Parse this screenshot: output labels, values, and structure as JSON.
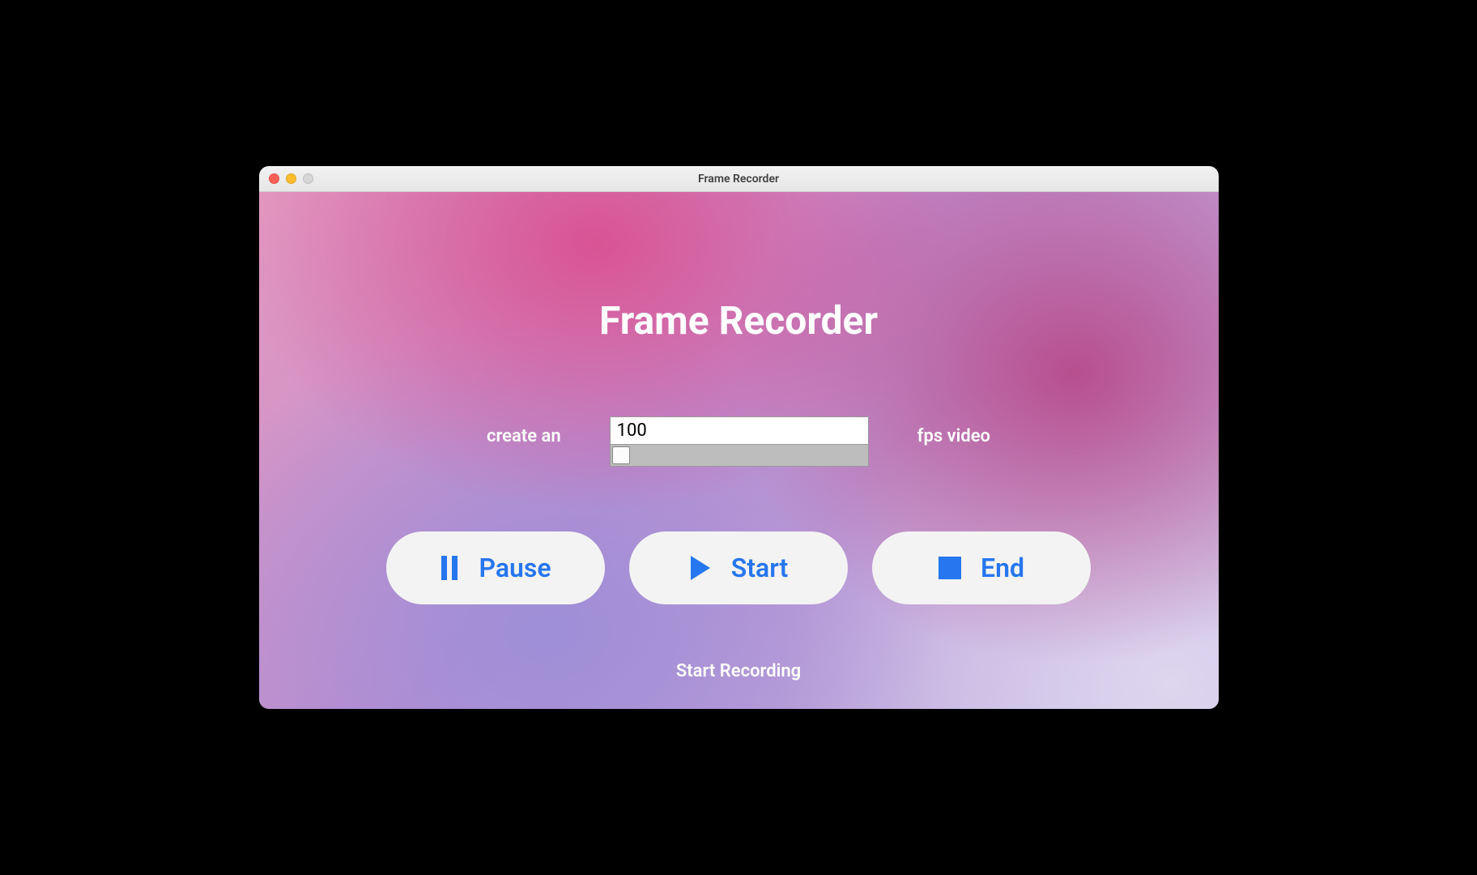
{
  "window": {
    "title": "Frame Recorder"
  },
  "main": {
    "app_title": "Frame Recorder",
    "fps": {
      "label_before": "create an",
      "label_after": "fps video",
      "value": "100"
    },
    "buttons": {
      "pause": "Pause",
      "start": "Start",
      "end": "End"
    },
    "status": "Start Recording",
    "accent_color": "#2676ef"
  }
}
